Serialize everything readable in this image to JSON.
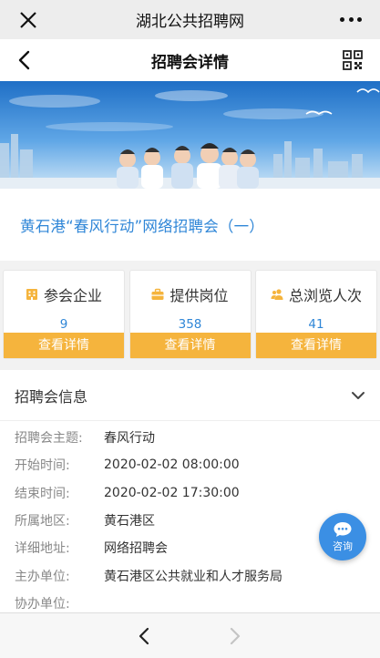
{
  "wechat_bar": {
    "title": "湖北公共招聘网"
  },
  "nav": {
    "title": "招聘会详情"
  },
  "fair": {
    "title": "黄石港“春风行动”网络招聘会（一）"
  },
  "stats": [
    {
      "label": "参会企业",
      "value": "9",
      "button": "查看详情",
      "icon": "building-icon"
    },
    {
      "label": "提供岗位",
      "value": "358",
      "button": "查看详情",
      "icon": "briefcase-icon"
    },
    {
      "label": "总浏览人次",
      "value": "41",
      "button": "查看详情",
      "icon": "people-icon"
    }
  ],
  "info": {
    "header": "招聘会信息",
    "rows": [
      {
        "key": "招聘会主题:",
        "value": "春风行动"
      },
      {
        "key": "开始时间:",
        "value": "2020-02-02 08:00:00"
      },
      {
        "key": "结束时间:",
        "value": "2020-02-02 17:30:00"
      },
      {
        "key": "所属地区:",
        "value": "黄石港区"
      },
      {
        "key": "详细地址:",
        "value": "网络招聘会"
      },
      {
        "key": "主办单位:",
        "value": "黄石港区公共就业和人才服务局"
      },
      {
        "key": "协办单位:",
        "value": ""
      }
    ]
  },
  "chat": {
    "label": "咨询"
  },
  "colors": {
    "accent_blue": "#2f86d7",
    "button_orange": "#f5b43d",
    "chat_blue": "#3b8fe4"
  }
}
